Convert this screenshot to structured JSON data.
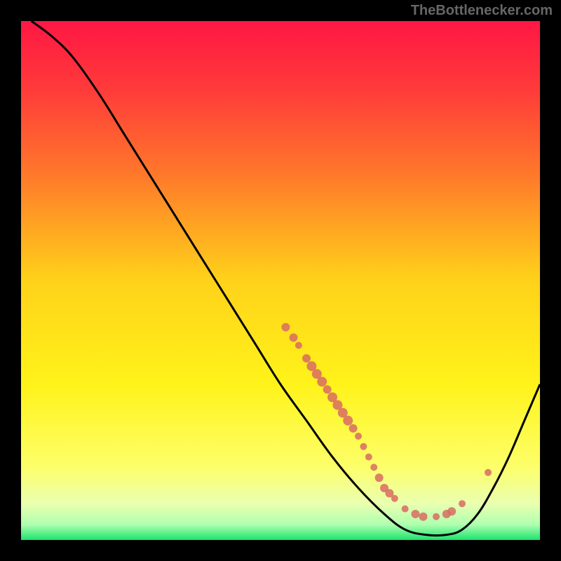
{
  "watermark": "TheBottlenecker.com",
  "chart_data": {
    "type": "line",
    "title": "",
    "xlabel": "",
    "ylabel": "",
    "xlim": [
      0,
      100
    ],
    "ylim": [
      0,
      100
    ],
    "background": {
      "type": "vertical-gradient",
      "stops": [
        {
          "pos": 0,
          "color": "#ff1744"
        },
        {
          "pos": 0.13,
          "color": "#ff3a3a"
        },
        {
          "pos": 0.3,
          "color": "#ff7a2a"
        },
        {
          "pos": 0.5,
          "color": "#ffd21a"
        },
        {
          "pos": 0.7,
          "color": "#fff31a"
        },
        {
          "pos": 0.86,
          "color": "#fdff6a"
        },
        {
          "pos": 0.93,
          "color": "#eaffb0"
        },
        {
          "pos": 0.97,
          "color": "#b0ffb0"
        },
        {
          "pos": 1.0,
          "color": "#1de36e"
        }
      ]
    },
    "series": [
      {
        "name": "curve",
        "type": "line",
        "points": [
          {
            "x": 2,
            "y": 100
          },
          {
            "x": 6,
            "y": 97
          },
          {
            "x": 10,
            "y": 93
          },
          {
            "x": 15,
            "y": 86
          },
          {
            "x": 20,
            "y": 78
          },
          {
            "x": 25,
            "y": 70
          },
          {
            "x": 30,
            "y": 62
          },
          {
            "x": 35,
            "y": 54
          },
          {
            "x": 40,
            "y": 46
          },
          {
            "x": 45,
            "y": 38
          },
          {
            "x": 50,
            "y": 30
          },
          {
            "x": 55,
            "y": 23
          },
          {
            "x": 60,
            "y": 16
          },
          {
            "x": 65,
            "y": 10
          },
          {
            "x": 70,
            "y": 5
          },
          {
            "x": 74,
            "y": 2
          },
          {
            "x": 78,
            "y": 1
          },
          {
            "x": 82,
            "y": 1
          },
          {
            "x": 85,
            "y": 2
          },
          {
            "x": 88,
            "y": 5
          },
          {
            "x": 91,
            "y": 10
          },
          {
            "x": 94,
            "y": 16
          },
          {
            "x": 97,
            "y": 23
          },
          {
            "x": 100,
            "y": 30
          }
        ]
      },
      {
        "name": "dots",
        "type": "scatter",
        "color": "#d86b63",
        "points": [
          {
            "x": 51,
            "y": 41,
            "r": 6
          },
          {
            "x": 52.5,
            "y": 39,
            "r": 6
          },
          {
            "x": 53.5,
            "y": 37.5,
            "r": 5
          },
          {
            "x": 55,
            "y": 35,
            "r": 6
          },
          {
            "x": 56,
            "y": 33.5,
            "r": 7
          },
          {
            "x": 57,
            "y": 32,
            "r": 7
          },
          {
            "x": 58,
            "y": 30.5,
            "r": 7
          },
          {
            "x": 59,
            "y": 29,
            "r": 6
          },
          {
            "x": 60,
            "y": 27.5,
            "r": 7
          },
          {
            "x": 61,
            "y": 26,
            "r": 7
          },
          {
            "x": 62,
            "y": 24.5,
            "r": 7
          },
          {
            "x": 63,
            "y": 23,
            "r": 7
          },
          {
            "x": 64,
            "y": 21.5,
            "r": 6
          },
          {
            "x": 65,
            "y": 20,
            "r": 5
          },
          {
            "x": 66,
            "y": 18,
            "r": 5
          },
          {
            "x": 67,
            "y": 16,
            "r": 5
          },
          {
            "x": 68,
            "y": 14,
            "r": 5
          },
          {
            "x": 69,
            "y": 12,
            "r": 6
          },
          {
            "x": 70,
            "y": 10,
            "r": 6
          },
          {
            "x": 71,
            "y": 9,
            "r": 6
          },
          {
            "x": 72,
            "y": 8,
            "r": 5
          },
          {
            "x": 74,
            "y": 6,
            "r": 5
          },
          {
            "x": 76,
            "y": 5,
            "r": 6
          },
          {
            "x": 77.5,
            "y": 4.5,
            "r": 6
          },
          {
            "x": 80,
            "y": 4.5,
            "r": 5
          },
          {
            "x": 82,
            "y": 5,
            "r": 6
          },
          {
            "x": 83,
            "y": 5.5,
            "r": 6
          },
          {
            "x": 85,
            "y": 7,
            "r": 5
          },
          {
            "x": 90,
            "y": 13,
            "r": 5
          }
        ]
      }
    ]
  }
}
